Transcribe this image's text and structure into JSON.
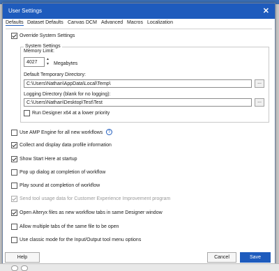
{
  "window": {
    "title": "User Settings",
    "close_icon": "close-icon"
  },
  "tabs": [
    {
      "label": "Defaults",
      "active": true
    },
    {
      "label": "Dataset Defaults"
    },
    {
      "label": "Canvas"
    },
    {
      "label": "DCM"
    },
    {
      "label": "Advanced"
    },
    {
      "label": "Macros"
    },
    {
      "label": "Localization"
    }
  ],
  "override": {
    "label": "Override System Settings",
    "checked": true
  },
  "system_settings": {
    "legend": "System Settings",
    "memory_label": "Memory Limit:",
    "memory_value": "4027",
    "memory_unit": "Megabytes",
    "temp_dir_label": "Default Temporary Directory:",
    "temp_dir_value": "C:\\Users\\Nathan\\AppData\\Local\\Temp\\",
    "log_dir_label": "Logging Directory (blank for no logging):",
    "log_dir_value": "C:\\Users\\Nathan\\Desktop\\Test\\Test",
    "browse_label": "...",
    "run_x64_label": "Run Designer x64 at a lower priority",
    "run_x64_checked": false
  },
  "options": [
    {
      "label": "Use AMP Engine for all new workflows",
      "checked": false
    },
    {
      "label": "Collect and display data profile information",
      "checked": true
    },
    {
      "label": "Show Start Here at startup",
      "checked": true
    },
    {
      "label": "Pop up dialog at completion of workflow",
      "checked": false
    },
    {
      "label": "Play sound at completion of workflow",
      "checked": false
    },
    {
      "label": "Send tool usage data for Customer Experience Improvement program",
      "checked": true,
      "disabled": true
    },
    {
      "label": "Open Alteryx files as new workflow tabs in same Designer window",
      "checked": true
    },
    {
      "label": "Allow multiple tabs of the same file to be open",
      "checked": false
    },
    {
      "label": "Use classic mode for the Input/Output tool menu options",
      "checked": false
    }
  ],
  "help_glyph": "?",
  "footer": {
    "help_label": "Help",
    "cancel_label": "Cancel",
    "save_label": "Save"
  },
  "colors": {
    "title_bar": "#1e5bbd",
    "primary_button": "#1e5bbd"
  }
}
